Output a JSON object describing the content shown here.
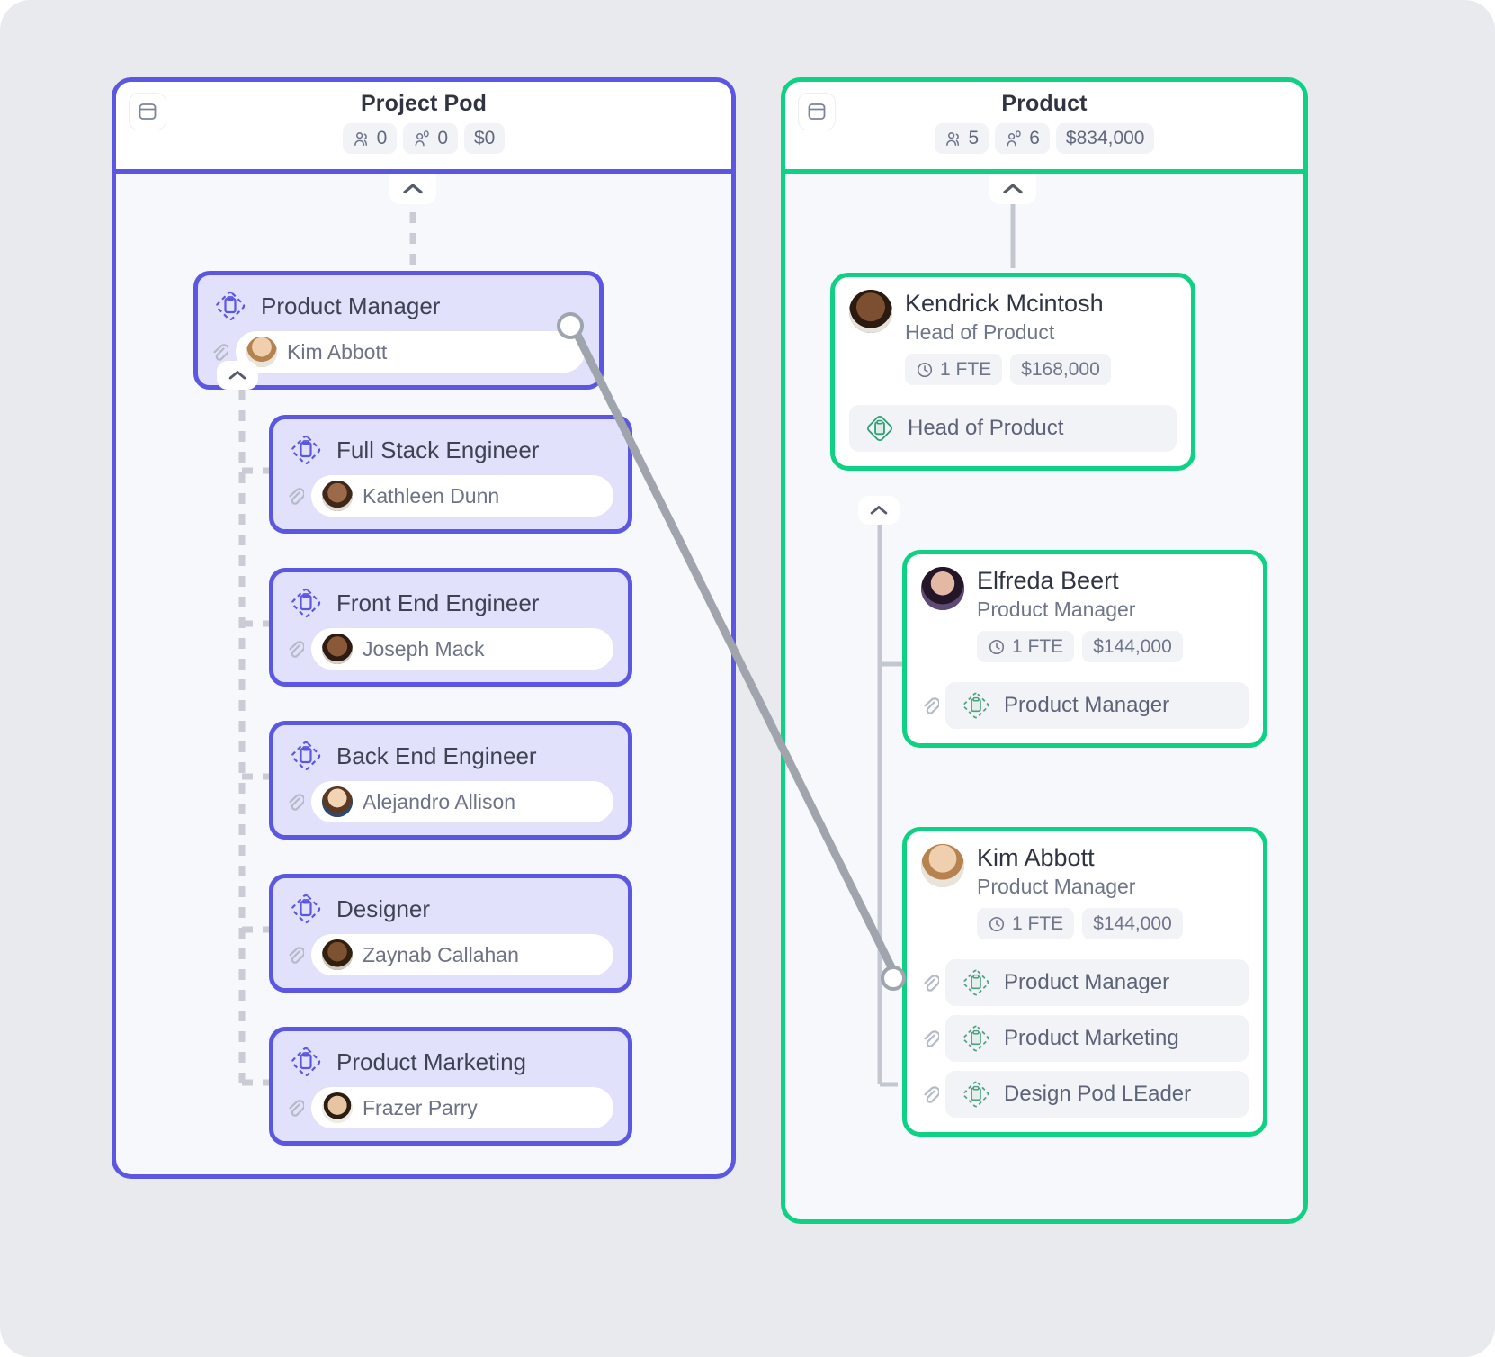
{
  "colors": {
    "canvas_bg": "#e8eaee",
    "pod_accent": "#5b57e0",
    "team_accent": "#0fd183",
    "panel_bg": "#f7f8fc",
    "role_card_bg": "#e2e1fb",
    "connector": "#a0a4ad"
  },
  "panels": [
    {
      "id": "project-pod",
      "title": "Project Pod",
      "accent": "#5b57e0",
      "icon": "panel-card-icon",
      "stats": [
        {
          "icon": "people-icon",
          "value": "0"
        },
        {
          "icon": "person-zero-icon",
          "value": "0"
        },
        {
          "icon": "none",
          "value": "$0"
        }
      ],
      "root_role": {
        "title": "Product Manager",
        "icon": "role-diamond-icon",
        "assignee": {
          "name": "Kim Abbott",
          "avatar": "kim-abbott-avatar",
          "attachment_icon": "paperclip-icon"
        }
      },
      "children": [
        {
          "title": "Full Stack Engineer",
          "icon": "role-diamond-icon",
          "assignee": {
            "name": "Kathleen Dunn",
            "avatar": "kathleen-dunn-avatar",
            "attachment_icon": "paperclip-icon"
          }
        },
        {
          "title": "Front End Engineer",
          "icon": "role-diamond-icon",
          "assignee": {
            "name": "Joseph Mack",
            "avatar": "joseph-mack-avatar",
            "attachment_icon": "paperclip-icon"
          }
        },
        {
          "title": "Back End Engineer",
          "icon": "role-diamond-icon",
          "assignee": {
            "name": "Alejandro Allison",
            "avatar": "alejandro-allison-avatar",
            "attachment_icon": "paperclip-icon"
          }
        },
        {
          "title": "Designer",
          "icon": "role-diamond-icon",
          "assignee": {
            "name": "Zaynab Callahan",
            "avatar": "zaynab-callahan-avatar",
            "attachment_icon": "paperclip-icon"
          }
        },
        {
          "title": "Product Marketing",
          "icon": "role-diamond-icon",
          "assignee": {
            "name": "Frazer Parry",
            "avatar": "frazer-parry-avatar",
            "attachment_icon": "paperclip-icon"
          }
        }
      ]
    },
    {
      "id": "product",
      "title": "Product",
      "accent": "#0fd183",
      "icon": "panel-card-icon",
      "stats": [
        {
          "icon": "people-icon",
          "value": "5"
        },
        {
          "icon": "person-zero-icon",
          "value": "6"
        },
        {
          "icon": "none",
          "value": "$834,000"
        }
      ],
      "root_person": {
        "name": "Kendrick Mcintosh",
        "role": "Head of Product",
        "avatar": "kendrick-mcintosh-avatar",
        "chips": [
          {
            "icon": "clock-icon",
            "value": "1 FTE"
          },
          {
            "icon": "none",
            "value": "$168,000"
          }
        ],
        "roles": [
          {
            "label": "Head of Product",
            "icon": "role-diamond-solid-icon",
            "attachment": false
          }
        ]
      },
      "children": [
        {
          "name": "Elfreda Beert",
          "role": "Product Manager",
          "avatar": "elfreda-beert-avatar",
          "chips": [
            {
              "icon": "clock-icon",
              "value": "1 FTE"
            },
            {
              "icon": "none",
              "value": "$144,000"
            }
          ],
          "roles": [
            {
              "label": "Product Manager",
              "icon": "role-diamond-dashed-icon",
              "attachment": true
            }
          ]
        },
        {
          "name": "Kim Abbott",
          "role": "Product Manager",
          "avatar": "kim-abbott-avatar",
          "chips": [
            {
              "icon": "clock-icon",
              "value": "1 FTE"
            },
            {
              "icon": "none",
              "value": "$144,000"
            }
          ],
          "roles": [
            {
              "label": "Product Manager",
              "icon": "role-diamond-dashed-icon",
              "attachment": true
            },
            {
              "label": "Product Marketing",
              "icon": "role-diamond-dashed-icon",
              "attachment": true
            },
            {
              "label": "Design Pod LEader",
              "icon": "role-diamond-dashed-icon",
              "attachment": true
            }
          ]
        }
      ]
    }
  ],
  "cross_link": {
    "from": "project-pod.root_role.Product Manager",
    "to": "product.children.Kim Abbott",
    "handle_icon": "link-handle-icon"
  }
}
